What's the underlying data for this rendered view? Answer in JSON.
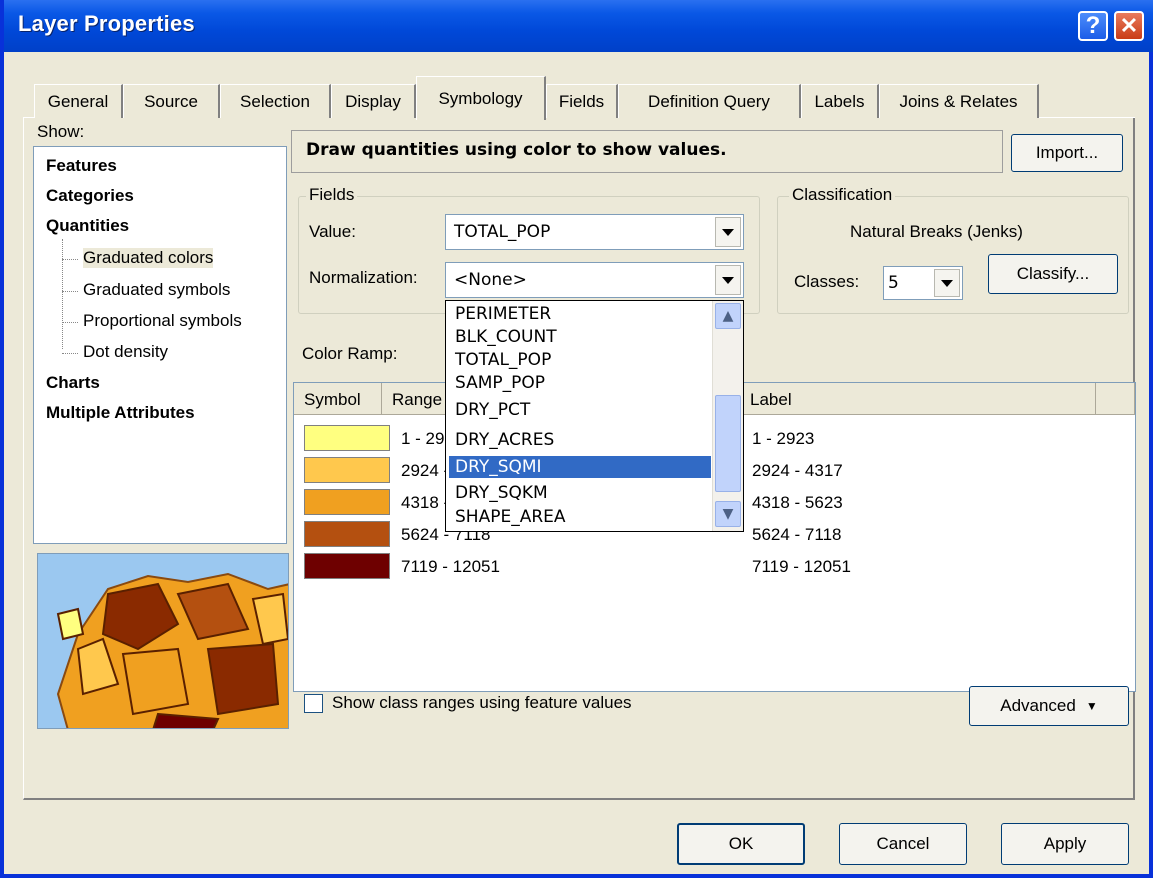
{
  "window": {
    "title": "Layer Properties",
    "help": "?",
    "close": "✕"
  },
  "tabs": [
    "General",
    "Source",
    "Selection",
    "Display",
    "Symbology",
    "Fields",
    "Definition Query",
    "Labels",
    "Joins & Relates"
  ],
  "show": {
    "label": "Show:",
    "items": [
      "Features",
      "Categories",
      "Quantities",
      "Graduated colors",
      "Graduated symbols",
      "Proportional symbols",
      "Dot density",
      "Charts",
      "Multiple Attributes"
    ],
    "selected": "Graduated colors"
  },
  "description": "Draw quantities using color to show values.",
  "import_button": "Import...",
  "fields": {
    "group_label": "Fields",
    "value_label": "Value:",
    "value": "TOTAL_POP",
    "normalization_label": "Normalization:",
    "normalization": "<None>"
  },
  "classification": {
    "group_label": "Classification",
    "method": "Natural Breaks (Jenks)",
    "classes_label": "Classes:",
    "classes": "5",
    "classify_button": "Classify..."
  },
  "color_ramp_label": "Color Ramp:",
  "table": {
    "headers": [
      "Symbol",
      "Range",
      "Label"
    ],
    "rows": [
      {
        "color": "#ffff80",
        "range": "1 - 2923",
        "label": "1 - 2923"
      },
      {
        "color": "#ffc84d",
        "range": "2924 - 4317",
        "label": "2924 - 4317"
      },
      {
        "color": "#f0a020",
        "range": "4318 - 5623",
        "label": "4318 - 5623"
      },
      {
        "color": "#b45010",
        "range": "5624 - 7118",
        "label": "5624 - 7118"
      },
      {
        "color": "#6e0000",
        "range": "7119 - 12051",
        "label": "7119 - 12051"
      }
    ]
  },
  "dropdown": {
    "items": [
      "PERIMETER",
      "BLK_COUNT",
      "TOTAL_POP",
      "SAMP_POP",
      "DRY_PCT",
      "DRY_ACRES",
      "DRY_SQMI",
      "DRY_SQKM",
      "SHAPE_AREA"
    ],
    "highlighted": "DRY_SQMI"
  },
  "show_class_ranges": {
    "label": "Show class ranges using feature values",
    "checked": false
  },
  "advanced_button": "Advanced",
  "footer": {
    "ok": "OK",
    "cancel": "Cancel",
    "apply": "Apply"
  }
}
